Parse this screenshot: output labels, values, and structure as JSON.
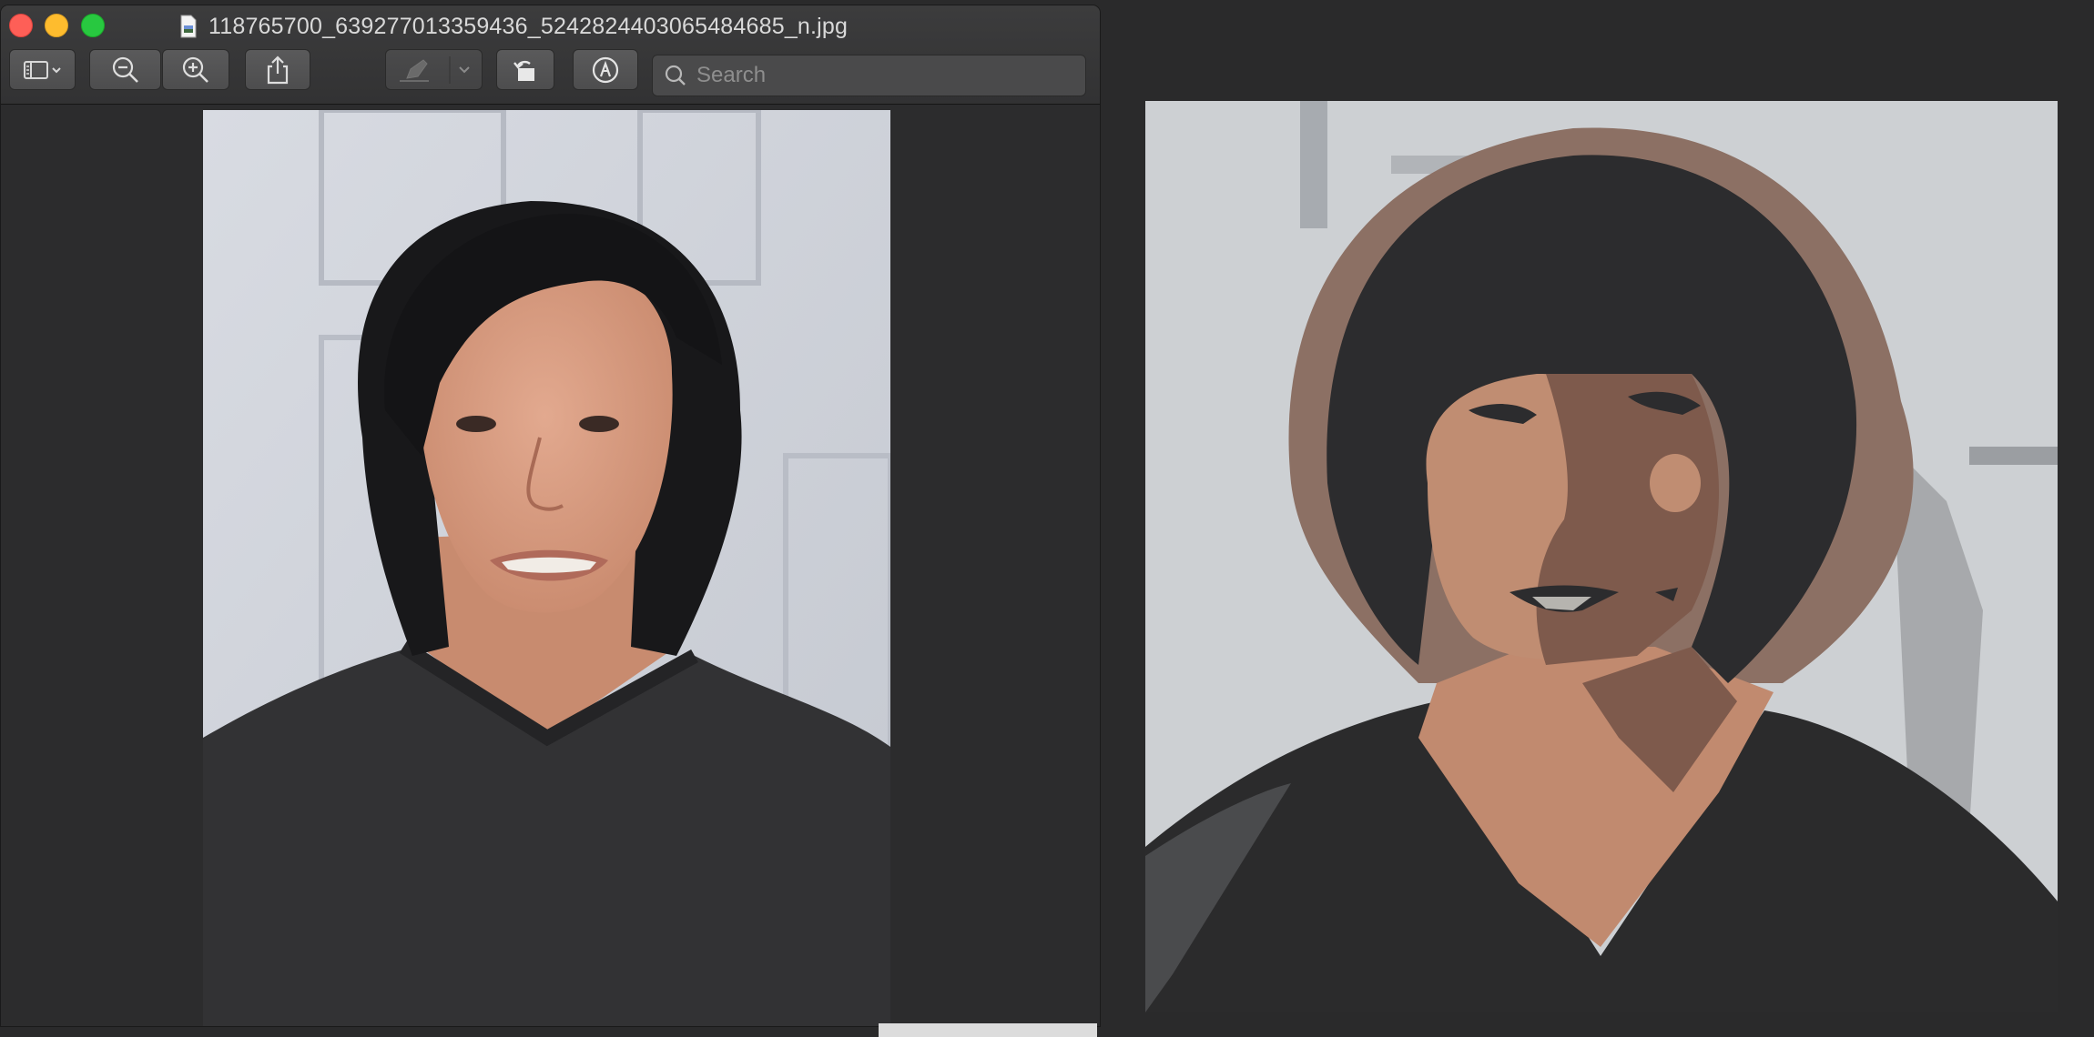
{
  "window": {
    "title": "118765700_639277013359436_5242824403065484685_n.jpg"
  },
  "toolbar": {
    "sidebar_icon": "sidebar-icon",
    "zoom_out_icon": "zoom-out-icon",
    "zoom_in_icon": "zoom-in-icon",
    "share_icon": "share-icon",
    "highlight_icon": "highlighter-icon",
    "rotate_icon": "rotate-icon",
    "markup_icon": "markup-icon"
  },
  "search": {
    "placeholder": "Search"
  },
  "colors": {
    "close": "#fe5f57",
    "minimize": "#febc2e",
    "maximize": "#28c840"
  }
}
